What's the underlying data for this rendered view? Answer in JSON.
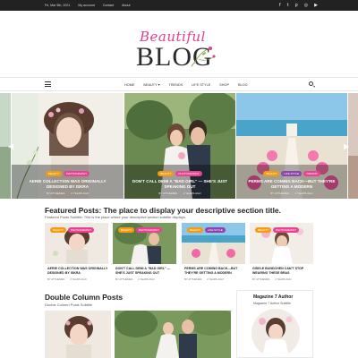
{
  "topbar": {
    "links": [
      "Fri, Mar 5th, 2021",
      "My account",
      "Contact",
      "About"
    ],
    "social_icons": [
      "facebook-icon",
      "twitter-icon",
      "pinterest-icon",
      "instagram-icon",
      "youtube-icon"
    ],
    "social_glyphs": [
      "f",
      "t",
      "p",
      "◎",
      "▶"
    ]
  },
  "logo": {
    "script": "Beautiful",
    "main": "BLOG"
  },
  "nav": {
    "items": [
      "HOME",
      "BEAUTY ▾",
      "TRENDS",
      "LIFE STYLE",
      "SHOP",
      "BLOG"
    ]
  },
  "slider": {
    "slides": [
      {
        "badges": [
          "BEAUTY",
          "PHOTOGRAPHY"
        ],
        "title": "AERIE COLLECTION WAS ORIGINALLY DESIGNED BY ISKRA",
        "author": "BY ATTHEMES",
        "date": "2 YEARS AGO"
      },
      {
        "badges": [
          "BEAUTY",
          "PHOTOGRAPHY"
        ],
        "title": "DON'T CALL DEMI A \"BAD GIRL\" — SHE'S JUST SPEAKING OUT",
        "author": "BY ATTHEMES",
        "date": "2 YEARS AGO"
      },
      {
        "badges": [
          "BEAUTY",
          "LIFE STYLE",
          "TRENDS"
        ],
        "title": "PERMS ARE COMING BACK—BUT THEY'RE GETTING A MODERN",
        "author": "BY ATTHEMES",
        "date": "2 YEARS AGO"
      }
    ],
    "prev_arrow": "◀",
    "next_arrow": "▶"
  },
  "featured": {
    "title": "Featured Posts: The place to display your descriptive section title.",
    "subtitle": "Featured Posts Subtitle: This is the place where your descriptive section subtitle displays.",
    "cards": [
      {
        "badges": [
          "BEAUTY",
          "PHOTOGRAPHY"
        ],
        "title": "AERIE COLLECTION WAS ORIGINALLY DESIGNED BY ISKRA",
        "author": "BY ATTHEMES",
        "date": "2 YEARS AGO"
      },
      {
        "badges": [
          "BEAUTY",
          "PHOTOGRAPHY"
        ],
        "title": "DON'T CALL DEMI A \"BAD GIRL\" — SHE'S JUST SPEAKING OUT",
        "author": "BY ATTHEMES",
        "date": "2 YEARS AGO"
      },
      {
        "badges": [
          "BEAUTY",
          "LIFE STYLE"
        ],
        "title": "PERMS ARE COMING BACK—BUT THEY'RE GETTING A MODERN",
        "author": "BY ATTHEMES",
        "date": "2 YEARS AGO"
      },
      {
        "badges": [
          "BEAUTY",
          "PHOTOGRAPHY"
        ],
        "title": "GISELE BUNDCHEN CAN'T STOP WEARING THESE BRAS",
        "author": "BY ATTHEMES",
        "date": "2 YEARS AGO"
      }
    ]
  },
  "double_column": {
    "title": "Double Column Posts",
    "subtitle": "Double Column Posts Subtitle"
  },
  "author_widget": {
    "title": "Magazine 7 Author",
    "subtitle": "Magazine 7 Author Subtitle"
  },
  "colors": {
    "accent": "#e0418c",
    "badge_orange": "#f39c12",
    "badge_pink": "#e84393",
    "badge_purple": "#8e44ad"
  }
}
